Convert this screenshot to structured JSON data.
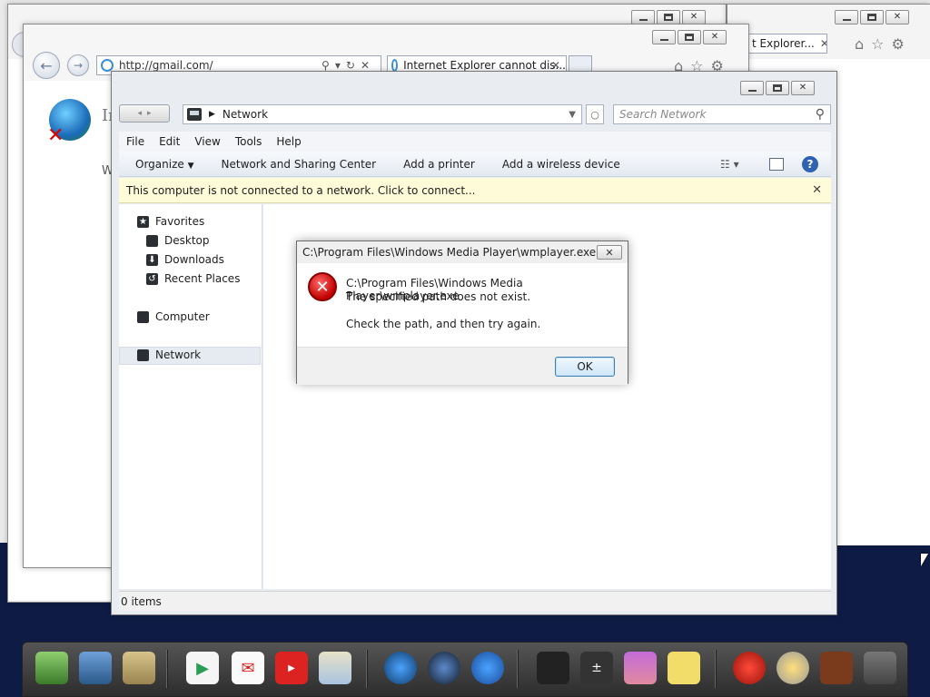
{
  "ie_gmail": {
    "address": "http://gmail.com/",
    "tab_title": "Internet Explorer cannot dis...",
    "content_letter": "In",
    "content_letter2": "W"
  },
  "ie_back2": {
    "tab_title": "t Explorer..."
  },
  "explorer": {
    "breadcrumb": "Network",
    "search_placeholder": "Search Network",
    "menu": [
      "File",
      "Edit",
      "View",
      "Tools",
      "Help"
    ],
    "commands": [
      "Organize",
      "Network and Sharing Center",
      "Add a printer",
      "Add a wireless device"
    ],
    "infobar_text": "This computer is not connected to a network. Click to connect...",
    "nav": {
      "favorites": "Favorites",
      "desktop": "Desktop",
      "downloads": "Downloads",
      "recent": "Recent Places",
      "computer": "Computer",
      "network": "Network"
    },
    "status": "0 items"
  },
  "error_dialog": {
    "title": "C:\\Program Files\\Windows Media Player\\wmplayer.exe",
    "line1": "C:\\Program Files\\Windows Media Player\\wmplayer.exe",
    "line2": "The specified path does not exist.",
    "line3": "Check the path, and then try again.",
    "ok_label": "OK"
  },
  "icons": {
    "close": "✕",
    "back": "←",
    "forward": "→",
    "search": "⚲",
    "help": "?",
    "error": "✕"
  }
}
